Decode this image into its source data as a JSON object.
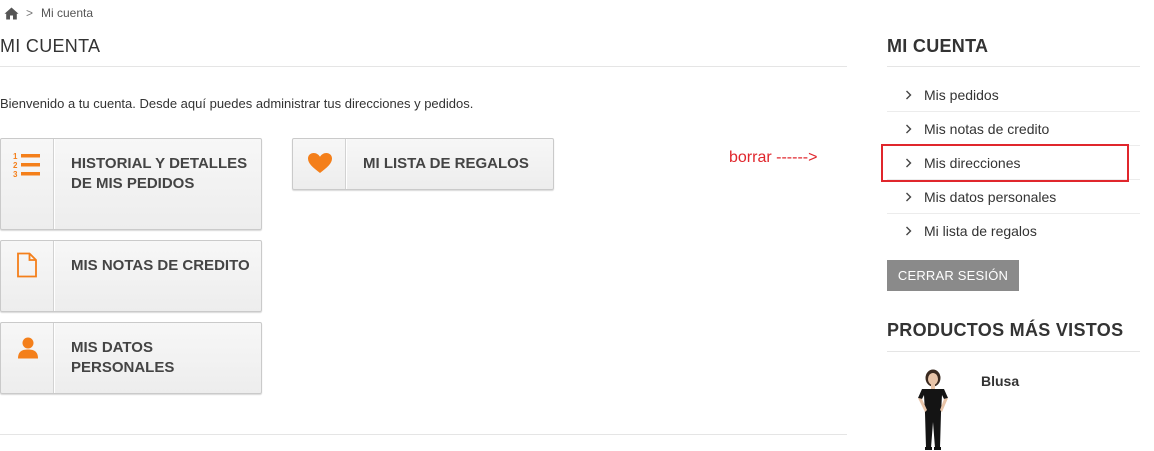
{
  "breadcrumb": {
    "home_icon": "home-icon",
    "separator": ">",
    "current": "Mi cuenta"
  },
  "main": {
    "title": "MI CUENTA",
    "welcome": "Bienvenido a tu cuenta. Desde aquí puedes administrar tus direcciones y pedidos.",
    "buttons": [
      {
        "label": "HISTORIAL Y DETALLES DE MIS PEDIDOS",
        "icon": "ordered-list-icon"
      },
      {
        "label": "MIS NOTAS DE CREDITO",
        "icon": "document-icon"
      },
      {
        "label": "MIS DATOS PERSONALES",
        "icon": "user-icon"
      },
      {
        "label": "MI LISTA DE REGALOS",
        "icon": "heart-icon"
      }
    ],
    "annotation": "borrar ------>"
  },
  "sidebar": {
    "title": "MI CUENTA",
    "items": [
      {
        "label": "Mis pedidos"
      },
      {
        "label": "Mis notas de credito"
      },
      {
        "label": "Mis direcciones",
        "highlighted": true
      },
      {
        "label": "Mis datos personales"
      },
      {
        "label": "Mi lista de regalos"
      }
    ],
    "logout_label": "CERRAR SESIÓN",
    "products_title": "PRODUCTOS MÁS VISTOS",
    "product": {
      "name": "Blusa"
    }
  },
  "colors": {
    "accent_orange": "#f47f1a",
    "annotation_red": "#e0262c",
    "logout_bg": "#8a8a8a"
  }
}
